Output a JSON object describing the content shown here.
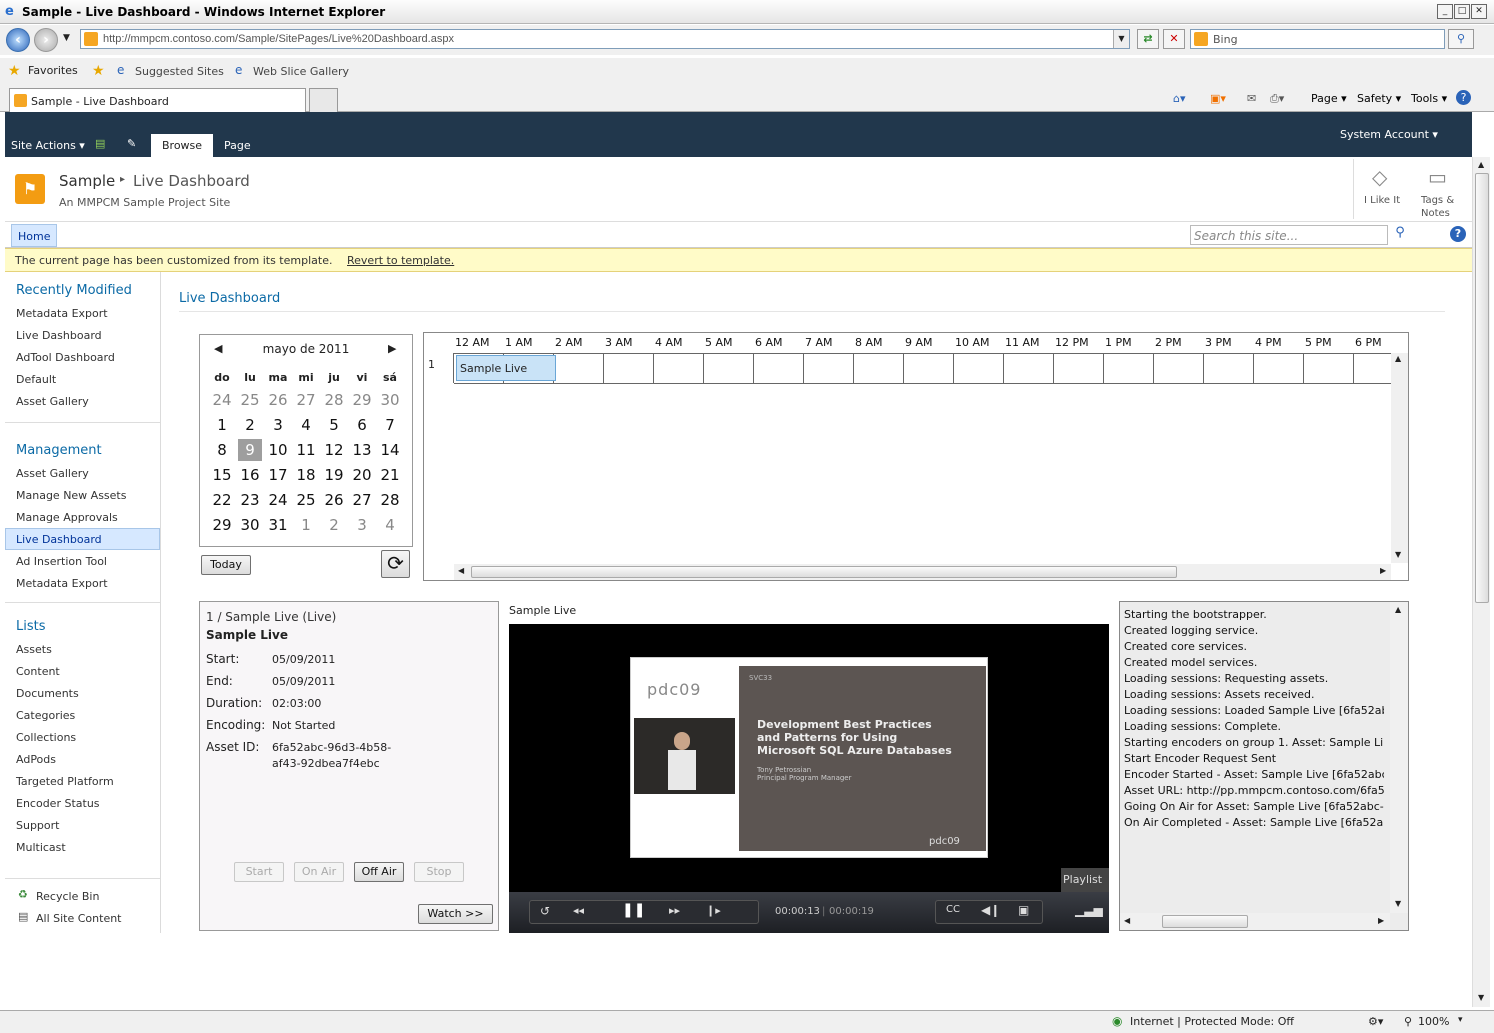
{
  "window": {
    "title": "Sample - Live Dashboard - Windows Internet Explorer"
  },
  "address": {
    "url": "http://mmpcm.contoso.com/Sample/SitePages/Live%20Dashboard.aspx",
    "search_placeholder": "Bing"
  },
  "favorites": {
    "label": "Favorites",
    "items": [
      "Suggested Sites",
      "Web Slice Gallery"
    ]
  },
  "tab": {
    "label": "Sample - Live Dashboard"
  },
  "commands": {
    "page": "Page",
    "safety": "Safety",
    "tools": "Tools"
  },
  "ribbon": {
    "site_actions": "Site Actions",
    "browse": "Browse",
    "page": "Page",
    "user": "System Account"
  },
  "site": {
    "title": "Sample",
    "page": "Live Dashboard",
    "description": "An MMPCM Sample Project Site",
    "i_like_it": "I Like It",
    "tags": "Tags &",
    "notes": "Notes"
  },
  "topnav": {
    "home": "Home",
    "search_placeholder": "Search this site..."
  },
  "infobar": {
    "text": "The current page has been customized from its template.",
    "link": "Revert to template."
  },
  "quicklaunch": {
    "recent_heading": "Recently Modified",
    "recent": [
      "Metadata Export",
      "Live Dashboard",
      "AdTool Dashboard",
      "Default",
      "Asset Gallery"
    ],
    "management_heading": "Management",
    "management": [
      "Asset Gallery",
      "Manage New Assets",
      "Manage Approvals",
      "Live Dashboard",
      "Ad Insertion Tool",
      "Metadata Export"
    ],
    "lists_heading": "Lists",
    "lists": [
      "Assets",
      "Content",
      "Documents",
      "Categories",
      "Collections",
      "AdPods",
      "Targeted Platform",
      "Encoder Status",
      "Support",
      "Multicast"
    ],
    "recycle": "Recycle Bin",
    "all_content": "All Site Content"
  },
  "main": {
    "heading": "Live Dashboard"
  },
  "calendar": {
    "month": "mayo de 2011",
    "days_header": [
      "do",
      "lu",
      "ma",
      "mi",
      "ju",
      "vi",
      "sá"
    ],
    "weeks": [
      [
        "24",
        "25",
        "26",
        "27",
        "28",
        "29",
        "30"
      ],
      [
        "1",
        "2",
        "3",
        "4",
        "5",
        "6",
        "7"
      ],
      [
        "8",
        "9",
        "10",
        "11",
        "12",
        "13",
        "14"
      ],
      [
        "15",
        "16",
        "17",
        "18",
        "19",
        "20",
        "21"
      ],
      [
        "22",
        "23",
        "24",
        "25",
        "26",
        "27",
        "28"
      ],
      [
        "29",
        "30",
        "31",
        "1",
        "2",
        "3",
        "4"
      ]
    ],
    "selected": "9",
    "today_label": "Today"
  },
  "timeline": {
    "hours": [
      "12 AM",
      "1 AM",
      "2 AM",
      "3 AM",
      "4 AM",
      "5 AM",
      "6 AM",
      "7 AM",
      "8 AM",
      "9 AM",
      "10 AM",
      "11 AM",
      "12 PM",
      "1 PM",
      "2 PM",
      "3 PM",
      "4 PM",
      "5 PM",
      "6 PM"
    ],
    "row_number": "1",
    "event": "Sample Live"
  },
  "info": {
    "header": "1 / Sample Live (Live)",
    "name": "Sample Live",
    "start_label": "Start:",
    "start": "05/09/2011",
    "end_label": "End:",
    "end": "05/09/2011",
    "duration_label": "Duration:",
    "duration": "02:03:00",
    "encoding_label": "Encoding:",
    "encoding": "Not Started",
    "asset_label": "Asset ID:",
    "asset_id_1": "6fa52abc-96d3-4b58-",
    "asset_id_2": "af43-92dbea7f4ebc",
    "btn_start": "Start",
    "btn_onair": "On Air",
    "btn_offair": "Off Air",
    "btn_stop": "Stop",
    "watch": "Watch >>"
  },
  "player": {
    "title": "Sample Live",
    "slide_title": "Development Best Practices and Patterns for Using Microsoft SQL Azure Databases",
    "slide_presenter": "Tony Petrossian",
    "slide_role": "Principal Program Manager",
    "slide_code": "SVC33",
    "logo": "pdc09",
    "playlist": "Playlist",
    "time_current": "00:00:13",
    "time_total": "00:00:19"
  },
  "log": {
    "lines": [
      "Starting the bootstrapper.",
      "Created logging service.",
      "Created core services.",
      "Created model services.",
      "Loading sessions: Requesting assets.",
      "Loading sessions: Assets received.",
      "Loading sessions: Loaded Sample Live [6fa52ab",
      "Loading sessions: Complete.",
      "Starting encoders on group 1. Asset: Sample Li",
      "Start Encoder Request Sent",
      "Encoder Started - Asset: Sample Live [6fa52abc",
      "Asset URL: http://pp.mmpcm.contoso.com/6fa5",
      "Going On Air for Asset: Sample Live [6fa52abc-",
      "On Air Completed - Asset: Sample Live [6fa52a"
    ]
  },
  "status": {
    "zone": "Internet | Protected Mode: Off",
    "zoom": "100%"
  }
}
